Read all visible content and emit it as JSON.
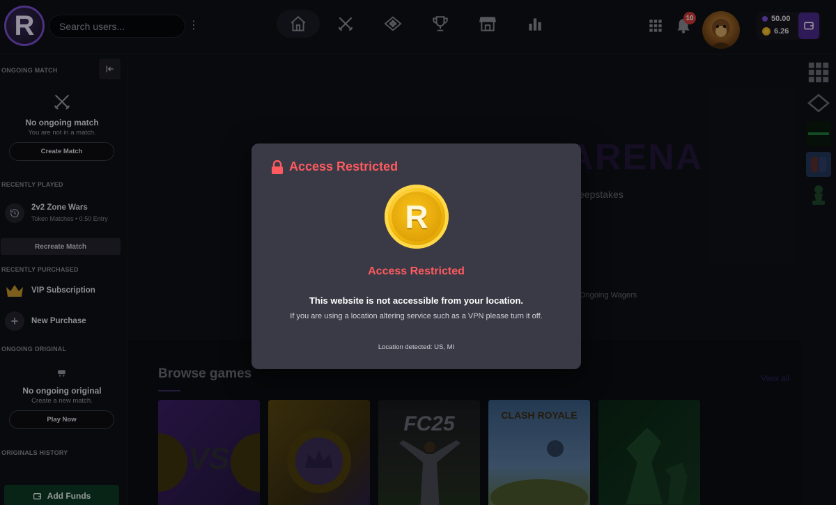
{
  "header": {
    "logo_letter": "R",
    "search_placeholder": "Search users...",
    "notifications_count": "10",
    "balance_primary": "50.00",
    "balance_coins": "6.26",
    "nav": [
      {
        "name": "home",
        "icon": "home-icon"
      },
      {
        "name": "matches",
        "icon": "crossed-swords-icon"
      },
      {
        "name": "wagers",
        "icon": "diamond-icon"
      },
      {
        "name": "leaderboard",
        "icon": "trophy-icon"
      },
      {
        "name": "shop",
        "icon": "store-icon"
      },
      {
        "name": "stats",
        "icon": "bar-chart-icon"
      }
    ]
  },
  "sidebar": {
    "ongoing_match": {
      "section_title": "ONGOING MATCH",
      "heading": "No ongoing match",
      "subtext": "You are not in a match.",
      "button": "Create Match"
    },
    "recently_played": {
      "section_title": "RECENTLY PLAYED",
      "game_title": "2v2 Zone Wars",
      "game_meta": "Token Matches • 0.50 Entry",
      "button": "Recreate Match"
    },
    "recently_purchased": {
      "section_title": "RECENTLY PURCHASED",
      "items": [
        "VIP Subscription",
        "New Purchase"
      ]
    },
    "ongoing_original": {
      "section_title": "ONGOING ORIGINAL",
      "heading": "No ongoing original",
      "subtext": "Create a new match.",
      "button": "Play Now"
    },
    "originals_history": {
      "section_title": "ORIGINALS HISTORY"
    },
    "add_funds": "Add Funds"
  },
  "main": {
    "hero_title": "DOMINATE THE ARENA",
    "hero_sub": "eepstakes",
    "hero_stat": "Ongoing Wagers",
    "browse_title": "Browse games",
    "view_all": "View all",
    "cards": [
      {
        "name": "vs-card",
        "label": "VS"
      },
      {
        "name": "crown-coin-card",
        "label": ""
      },
      {
        "name": "fc25-card",
        "label": "FC25"
      },
      {
        "name": "clash-royale-card",
        "label": "CLASH ROYALE"
      },
      {
        "name": "chess-card",
        "label": ""
      }
    ]
  },
  "modal": {
    "header_title": "Access Restricted",
    "coin_letter": "R",
    "sub_title": "Access Restricted",
    "message": "This website is not accessible from your location.",
    "note": "If you are using a location altering service such as a VPN please turn it off.",
    "location": "Location detected: US, MI"
  },
  "colors": {
    "accent_purple": "#7b4fd6",
    "danger": "#ff5a5f",
    "gold": "#f9c41a",
    "add_funds_green": "#0e3a26"
  }
}
